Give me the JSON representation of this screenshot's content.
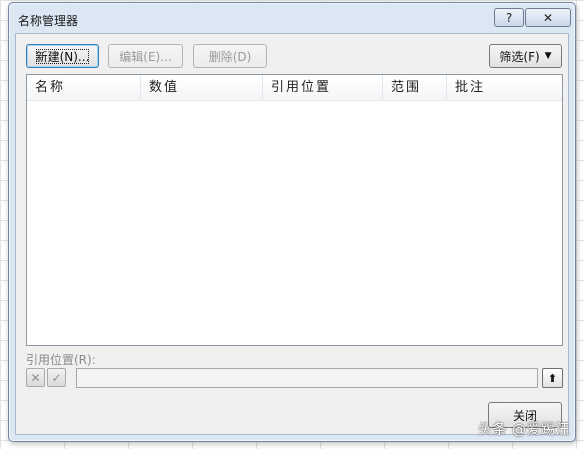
{
  "dialog": {
    "title": "名称管理器",
    "help_label": "?",
    "close_label": "✕"
  },
  "toolbar": {
    "new_label": "新建(N)...",
    "edit_label": "编辑(E)...",
    "delete_label": "删除(D)",
    "filter_label": "筛选(F)",
    "filter_arrow": "▼"
  },
  "list": {
    "columns": [
      "名称",
      "数值",
      "引用位置",
      "范围",
      "批注"
    ],
    "rows": []
  },
  "reference": {
    "label": "引用位置(R):",
    "cancel_icon": "✕",
    "confirm_icon": "✓",
    "value": "",
    "collapse_icon": "⬆"
  },
  "footer": {
    "close_label": "关闭"
  },
  "watermark": "头条 @爱踢汪"
}
